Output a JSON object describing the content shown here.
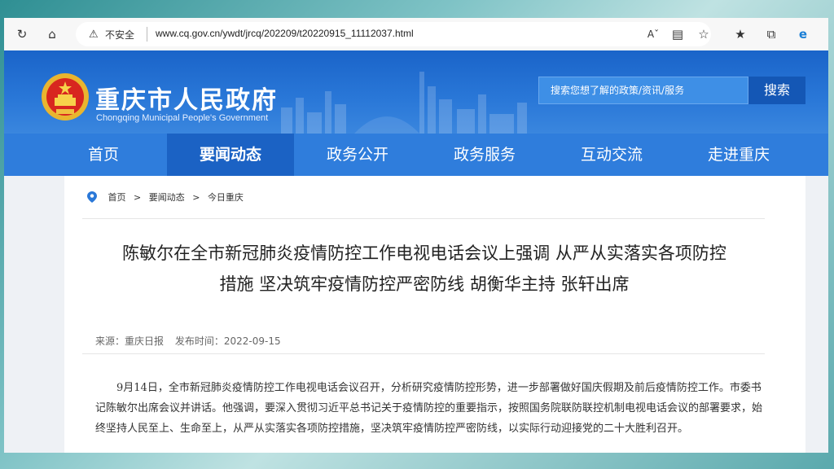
{
  "browser": {
    "security_label": "不安全",
    "url": "www.cq.gov.cn/ywdt/jrcq/202209/t20220915_11112037.html"
  },
  "header": {
    "title": "重庆市人民政府",
    "subtitle": "Chongqing Municipal People's Government",
    "search_placeholder": "搜索您想了解的政策/资讯/服务",
    "search_button": "搜索"
  },
  "nav": {
    "items": [
      "首页",
      "要闻动态",
      "政务公开",
      "政务服务",
      "互动交流",
      "走进重庆"
    ],
    "active": "要闻动态"
  },
  "breadcrumb": {
    "items": [
      "首页",
      ">",
      "要闻动态",
      ">",
      "今日重庆"
    ]
  },
  "article": {
    "title_line1": "陈敏尔在全市新冠肺炎疫情防控工作电视电话会议上强调 从严从实落实各项防控",
    "title_line2": "措施 坚决筑牢疫情防控严密防线 胡衡华主持 张轩出席",
    "source": "来源：重庆日报",
    "published": "发布时间：2022-09-15",
    "body": "9月14日，全市新冠肺炎疫情防控工作电视电话会议召开，分析研究疫情防控形势，进一步部署做好国庆假期及前后疫情防控工作。市委书记陈敏尔出席会议并讲话。他强调，要深入贯彻习近平总书记关于疫情防控的重要指示，按照国务院联防联控机制电视电话会议的部署要求，始终坚持人民至上、生命至上，从严从实落实各项防控措施，坚决筑牢疫情防控严密防线，以实际行动迎接党的二十大胜利召开。"
  },
  "colors": {
    "header_blue": "#2a78d8",
    "nav_active": "#1b62c4",
    "search_button": "#1457b5"
  }
}
